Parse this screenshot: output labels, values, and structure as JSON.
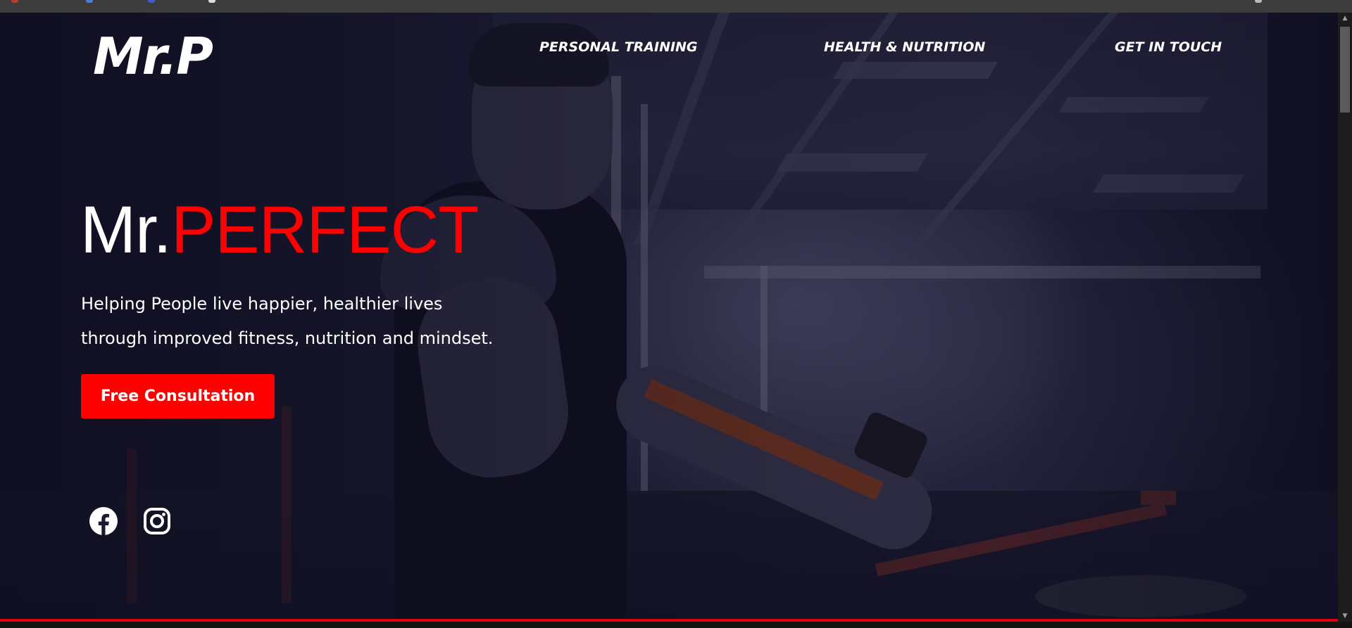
{
  "brand": {
    "logo_text": "Mr.P",
    "accent_color": "#ff0000"
  },
  "nav": {
    "items": [
      {
        "label": "PERSONAL TRAINING"
      },
      {
        "label": "HEALTH & NUTRITION"
      },
      {
        "label": "GET IN TOUCH"
      }
    ]
  },
  "hero": {
    "title_prefix": "Mr.",
    "title_accent": "PERFECT",
    "tagline_line1": "Helping People live happier, healthier lives",
    "tagline_line2": "through improved fitness, nutrition and mindset.",
    "cta_label": "Free Consultation"
  },
  "social": {
    "facebook_icon": "facebook-icon",
    "instagram_icon": "instagram-icon"
  },
  "scrollbar": {
    "up_arrow": "▲",
    "down_arrow": "▼"
  }
}
